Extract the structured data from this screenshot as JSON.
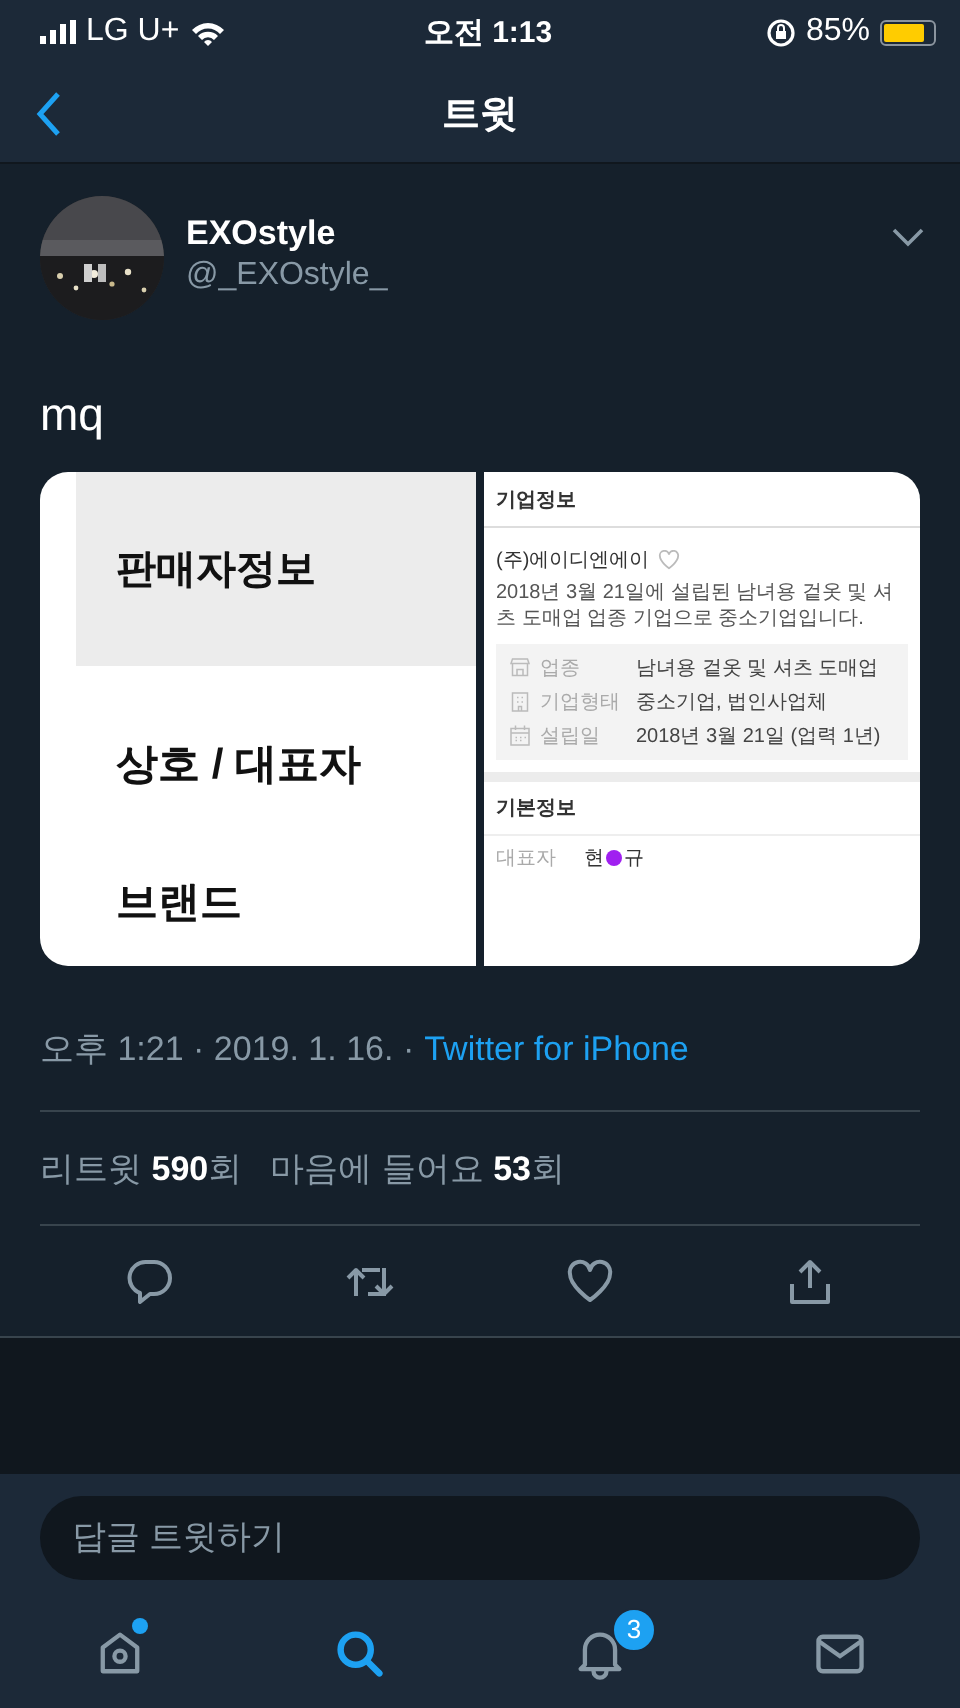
{
  "status_bar": {
    "carrier": "LG U+",
    "time": "오전 1:13",
    "battery": "85%"
  },
  "nav": {
    "title": "트윗"
  },
  "tweet": {
    "name": "EXOstyle",
    "handle": "@_EXOstyle_",
    "text": "mq",
    "media": {
      "left": {
        "heading": "판매자정보",
        "rows": [
          "상호 / 대표자",
          "브랜드"
        ]
      },
      "right": {
        "title": "기업정보",
        "company": "(주)에이디엔에이",
        "description": "2018년 3월 21일에 설립된 남녀용 겉옷 및 셔츠 도매업 업종 기업으로 중소기업입니다.",
        "info": [
          {
            "kind": "store",
            "label": "업종",
            "value": "남녀용 겉옷 및 셔츠 도매업"
          },
          {
            "kind": "building",
            "label": "기업형태",
            "value": "중소기업, 법인사업체"
          },
          {
            "kind": "calendar",
            "label": "설립일",
            "value": "2018년 3월 21일 (업력 1년)"
          }
        ],
        "section": "기본정보",
        "rep_label": "대표자",
        "rep_name_start": "현",
        "rep_name_end": "규"
      }
    },
    "meta": "오후 1:21 · 2019. 1. 16. ·",
    "source": "Twitter for iPhone",
    "stats": [
      "리트윗 **590**회",
      "마음에 들어요 **53**회"
    ]
  },
  "reply": {
    "placeholder": "답글 트윗하기"
  },
  "tabs": [
    {
      "kind": "home",
      "selected": false,
      "has_new": true
    },
    {
      "kind": "search",
      "selected": true,
      "has_new": false
    },
    {
      "kind": "notifications",
      "selected": false,
      "has_new": false,
      "badge": "3"
    },
    {
      "kind": "messages",
      "selected": false,
      "has_new": false
    }
  ]
}
